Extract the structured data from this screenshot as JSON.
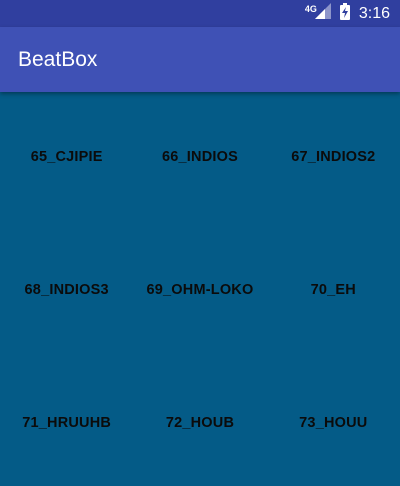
{
  "status_bar": {
    "network": "4G",
    "time": "3:16",
    "icons": [
      "signal-icon",
      "battery-charging-icon"
    ]
  },
  "app_bar": {
    "title": "BeatBox"
  },
  "sounds": [
    "65_CJIPIE",
    "66_INDIOS",
    "67_INDIOS2",
    "68_INDIOS3",
    "69_OHM-LOKO",
    "70_EH",
    "71_HRUUHB",
    "72_HOUB",
    "73_HOUU"
  ],
  "colors": {
    "status_bar": "#303f9f",
    "app_bar": "#3f51b5",
    "background": "#045b87",
    "button_text": "#0b0b0b"
  }
}
